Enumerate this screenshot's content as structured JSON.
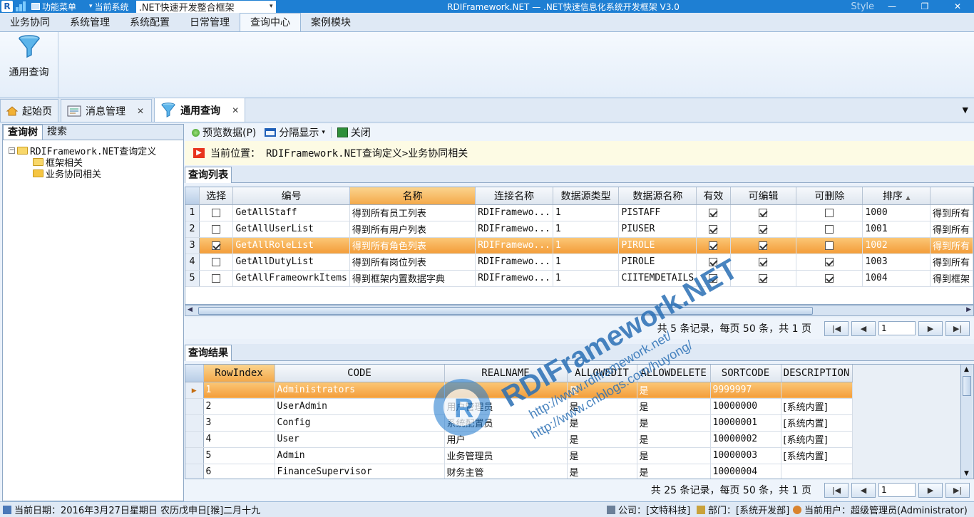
{
  "titlebar": {
    "menu_label": "功能菜单",
    "system_label": "当前系统",
    "system_value": ".NET快速开发整合框架",
    "title": "RDIFramework.NET — .NET快速信息化系统开发框架 V3.0",
    "style_label": "Style",
    "minimize": "—",
    "maximize": "❐",
    "close": "✕"
  },
  "ribbon": {
    "tabs": [
      "业务协同",
      "系统管理",
      "系统配置",
      "日常管理",
      "查询中心",
      "案例模块"
    ],
    "active_tab": "查询中心",
    "buttons": [
      {
        "label": "通用查询",
        "icon": "funnel-icon"
      }
    ]
  },
  "doc_tabs": [
    {
      "label": "起始页",
      "icon": "home-icon",
      "closable": false
    },
    {
      "label": "消息管理",
      "icon": "message-icon",
      "closable": true
    },
    {
      "label": "通用查询",
      "icon": "funnel-icon",
      "closable": true,
      "active": true
    }
  ],
  "left_panel": {
    "tabs": [
      "查询树",
      "搜索"
    ],
    "tree": {
      "root": "RDIFramework.NET查询定义",
      "children": [
        "框架相关",
        "业务协同相关"
      ]
    }
  },
  "toolbar": {
    "preview": "预览数据(P)",
    "split": "分隔显示",
    "close": "关闭"
  },
  "location": {
    "label": "当前位置：",
    "path": "RDIFramework.NET查询定义>业务协同相关"
  },
  "query_list": {
    "title": "查询列表",
    "columns": [
      "选择",
      "编号",
      "名称",
      "连接名称",
      "数据源类型",
      "数据源名称",
      "有效",
      "可编辑",
      "可删除",
      "排序",
      ""
    ],
    "rows": [
      {
        "idx": "1",
        "select": false,
        "code": "GetAllStaff",
        "name": "得到所有员工列表",
        "conn": "RDIFramewo...",
        "dstype": "1",
        "dsname": "PISTAFF",
        "valid": true,
        "editable": true,
        "deletable": false,
        "sort": "1000",
        "desc": "得到所有"
      },
      {
        "idx": "2",
        "select": false,
        "code": "GetAllUserList",
        "name": "得到所有用户列表",
        "conn": "RDIFramewo...",
        "dstype": "1",
        "dsname": "PIUSER",
        "valid": true,
        "editable": true,
        "deletable": false,
        "sort": "1001",
        "desc": "得到所有"
      },
      {
        "idx": "3",
        "select": true,
        "code": "GetAllRoleList",
        "name": "得到所有角色列表",
        "conn": "RDIFramewo...",
        "dstype": "1",
        "dsname": "PIROLE",
        "valid": true,
        "editable": true,
        "deletable": false,
        "sort": "1002",
        "desc": "得到所有"
      },
      {
        "idx": "4",
        "select": false,
        "code": "GetAllDutyList",
        "name": "得到所有岗位列表",
        "conn": "RDIFramewo...",
        "dstype": "1",
        "dsname": "PIROLE",
        "valid": true,
        "editable": true,
        "deletable": true,
        "sort": "1003",
        "desc": "得到所有"
      },
      {
        "idx": "5",
        "select": false,
        "code": "GetAllFrameowrkItems",
        "name": "得到框架内置数据字典",
        "conn": "RDIFramewo...",
        "dstype": "1",
        "dsname": "CIITEMDETAILS",
        "valid": true,
        "editable": true,
        "deletable": true,
        "sort": "1004",
        "desc": "得到框架"
      }
    ],
    "pager": {
      "summary": "共 5 条记录，每页 50 条，共 1 页",
      "page": "1"
    }
  },
  "query_result": {
    "title": "查询结果",
    "columns": [
      "RowIndex",
      "CODE",
      "REALNAME",
      "ALLOWEDIT",
      "ALLOWDELETE",
      "SORTCODE",
      "DESCRIPTION"
    ],
    "rows": [
      [
        "1",
        "Administrators",
        "",
        "是",
        "是",
        "9999997",
        ""
      ],
      [
        "2",
        "UserAdmin",
        "用户管理员",
        "是",
        "是",
        "10000000",
        "[系统内置]"
      ],
      [
        "3",
        "Config",
        "系统配置员",
        "是",
        "是",
        "10000001",
        "[系统内置]"
      ],
      [
        "4",
        "User",
        "用户",
        "是",
        "是",
        "10000002",
        "[系统内置]"
      ],
      [
        "5",
        "Admin",
        "业务管理员",
        "是",
        "是",
        "10000003",
        "[系统内置]"
      ],
      [
        "6",
        "FinanceSupervisor",
        "财务主管",
        "是",
        "是",
        "10000004",
        ""
      ]
    ],
    "pager": {
      "summary": "共 25 条记录，每页 50 条，共 1 页",
      "page": "1"
    }
  },
  "statusbar": {
    "date": "当前日期：2016年3月27日星期日 农历戊申日[猴]二月十九",
    "company": "公司：[文特科技]",
    "dept": "部门：[系统开发部]",
    "user": "当前用户：超级管理员(Administrator)"
  },
  "watermark": {
    "brand": "RDIFramework.NET",
    "url1": "http://www.rdiframework.net/",
    "url2": "http://www.cnblogs.com/huyong/"
  },
  "colors": {
    "accent": "#1e7fd3",
    "selection": "#f39d3a",
    "location_bg": "#fdfbe4"
  }
}
